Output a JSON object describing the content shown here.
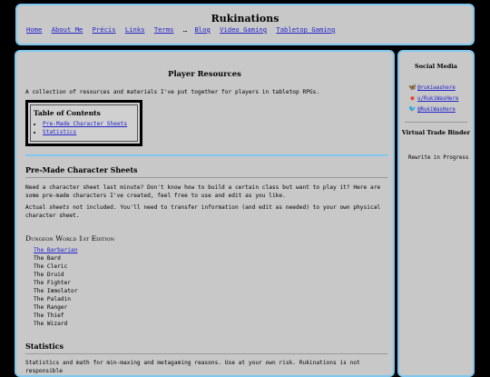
{
  "site": {
    "title": "Rukinations",
    "nav": [
      "Home",
      "About Me",
      "Précis",
      "Links",
      "Terms",
      "Blog",
      "Video Gaming",
      "Tabletop Gaming"
    ],
    "nav_separator": "…"
  },
  "main": {
    "title": "Player Resources",
    "intro": "A collection of resources and materials I've put together for players in tabletop RPGs.",
    "toc": {
      "title": "Table of Contents",
      "items": [
        "Pre-Made Character Sheets",
        "Statistics"
      ]
    },
    "section1": {
      "heading": "Pre-Made Character Sheets",
      "para1": "Need a character sheet last minute? Don't know how to build a certain class but want to play it? Here are some pre-made characters I've created, feel free to use and edit as you like.",
      "para2_pre": "Actual ",
      "para2_em": "sheets",
      "para2_post": " not included. You'll need to transfer information (and edit as needed) to your own physical character sheet.",
      "game": "Dungeon World 1st Edition",
      "characters": [
        "The Barbarian",
        "The Bard",
        "The Cleric",
        "The Druid",
        "The Fighter",
        "The Immolator",
        "The Paladin",
        "The Ranger",
        "The Thief",
        "The Wizard"
      ]
    },
    "section2": {
      "heading": "Statistics",
      "para": "Statistics and math for min-maxing and metagaming reasons. Use at your own risk. Rukinations is not responsible"
    }
  },
  "sidebar": {
    "social_title": "Social Media",
    "social": [
      {
        "icon": "bluesky-icon",
        "label": "@rukiwashere"
      },
      {
        "icon": "reddit-icon",
        "label": "u/RukiWasHere"
      },
      {
        "icon": "twitter-icon",
        "label": "@RukiWasHere"
      }
    ],
    "binder_title": "Virtual Trade Binder",
    "binder_status": "Rewrite in Progress"
  },
  "colors": {
    "panel": "#c8c8c8",
    "border": "#7ec8f0",
    "link": "#2222cc",
    "background": "#000000"
  }
}
